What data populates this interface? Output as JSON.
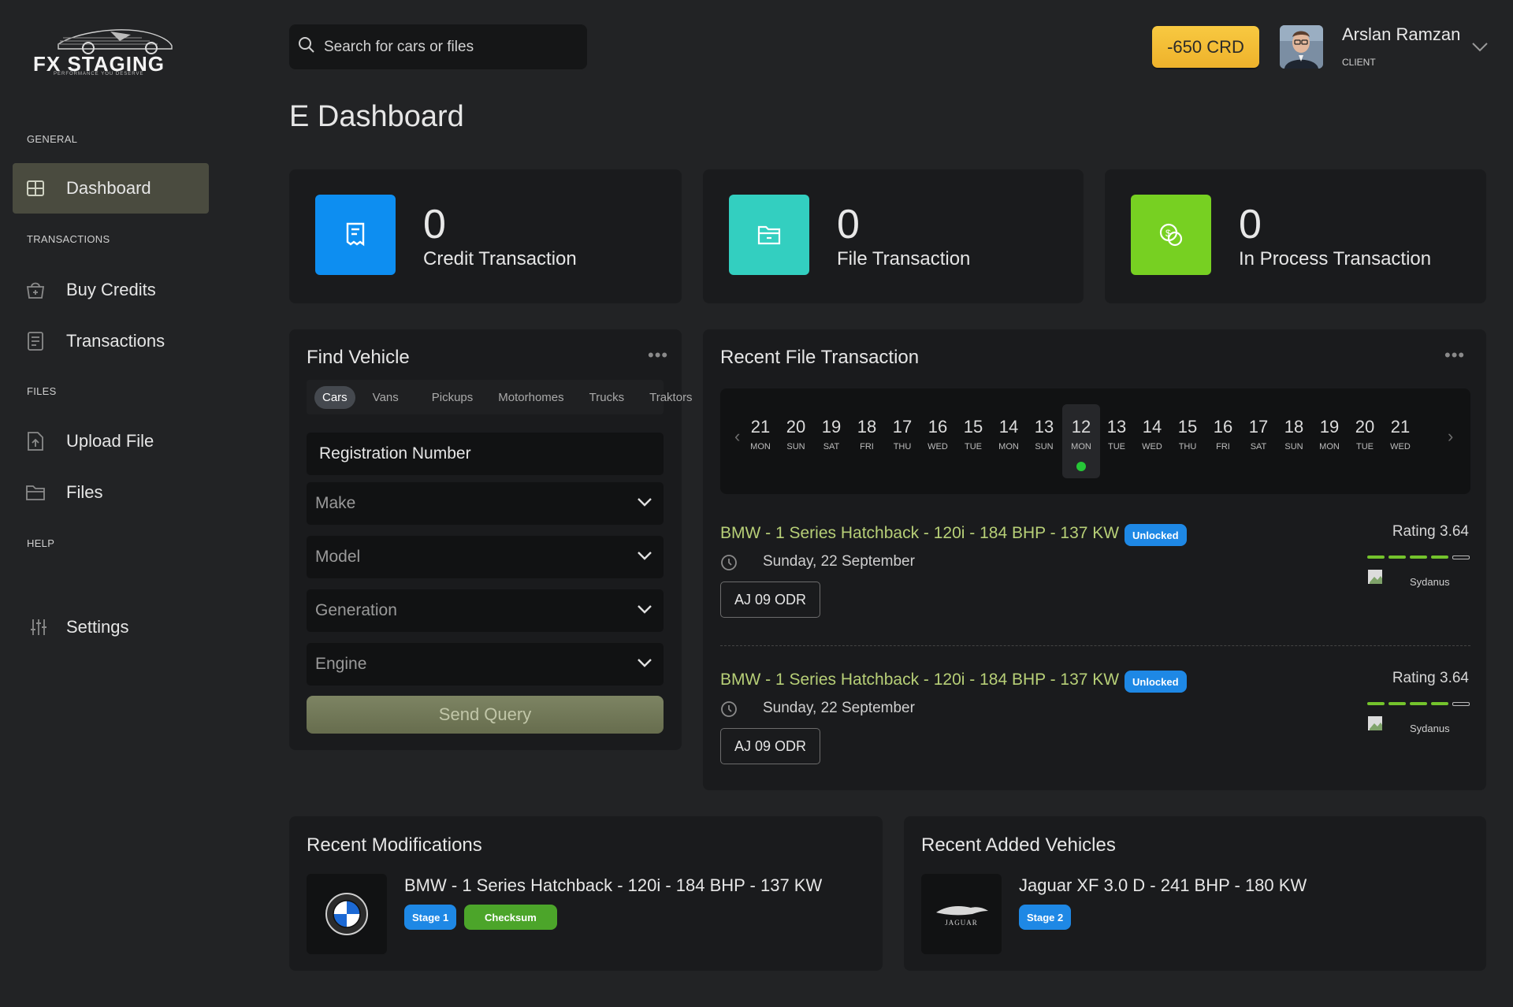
{
  "app": {
    "logo_text": "FX STAGING",
    "logo_tagline": "PERFORMANCE YOU DESERVE"
  },
  "sidebar": {
    "sections": {
      "general": "GENERAL",
      "transactions": "TRANSACTIONS",
      "files": "FILES",
      "help": "HELP"
    },
    "items": [
      {
        "label": "Dashboard",
        "icon": "grid-icon",
        "active": true
      },
      {
        "label": "Buy Credits",
        "icon": "cart-icon"
      },
      {
        "label": "Transactions",
        "icon": "receipt-icon"
      },
      {
        "label": "Upload File",
        "icon": "upload-file-icon"
      },
      {
        "label": "Files",
        "icon": "folder-icon"
      },
      {
        "label": "Settings",
        "icon": "sliders-icon"
      }
    ]
  },
  "search": {
    "placeholder": "Search for cars or files"
  },
  "header": {
    "credits": "-650 CRD",
    "user_name": "Arslan Ramzan",
    "user_role": "CLIENT"
  },
  "page_title": "E Dashboard",
  "stats": [
    {
      "value": "0",
      "label": "Credit Transaction",
      "color": "#0d8ef1",
      "icon": "receipt-icon"
    },
    {
      "value": "0",
      "label": "File Transaction",
      "color": "#33cfc0",
      "icon": "folder-icon"
    },
    {
      "value": "0",
      "label": "In Process Transaction",
      "color": "#77d022",
      "icon": "coins-icon"
    }
  ],
  "find_vehicle": {
    "title": "Find Vehicle",
    "tabs": [
      "Cars",
      "Vans",
      "Pickups",
      "Motorhomes",
      "Trucks",
      "Traktors"
    ],
    "active_tab": "Cars",
    "registration_placeholder": "Registration Number",
    "selects": [
      "Make",
      "Model",
      "Generation",
      "Engine"
    ],
    "submit": "Send Query"
  },
  "recent_file_transaction": {
    "title": "Recent File Transaction",
    "calendar": [
      {
        "num": "21",
        "dow": "MON"
      },
      {
        "num": "20",
        "dow": "SUN"
      },
      {
        "num": "19",
        "dow": "SAT"
      },
      {
        "num": "18",
        "dow": "FRI"
      },
      {
        "num": "17",
        "dow": "THU"
      },
      {
        "num": "16",
        "dow": "WED"
      },
      {
        "num": "15",
        "dow": "TUE"
      },
      {
        "num": "14",
        "dow": "MON"
      },
      {
        "num": "13",
        "dow": "SUN"
      },
      {
        "num": "12",
        "dow": "MON",
        "selected": true
      },
      {
        "num": "13",
        "dow": "TUE"
      },
      {
        "num": "14",
        "dow": "WED"
      },
      {
        "num": "15",
        "dow": "THU"
      },
      {
        "num": "16",
        "dow": "FRI"
      },
      {
        "num": "17",
        "dow": "SAT"
      },
      {
        "num": "18",
        "dow": "SUN"
      },
      {
        "num": "19",
        "dow": "MON"
      },
      {
        "num": "20",
        "dow": "TUE"
      },
      {
        "num": "21",
        "dow": "WED"
      }
    ],
    "items": [
      {
        "title": "BMW - 1 Series Hatchback - 120i - 184 BHP - 137 KW",
        "status": "Unlocked",
        "date": "Sunday, 22 September",
        "plate": "AJ 09 ODR",
        "rating_label": "Rating 3.64",
        "rating_filled": 4,
        "rating_total": 5,
        "user": "Sydanus"
      },
      {
        "title": "BMW - 1 Series Hatchback - 120i - 184 BHP - 137 KW",
        "status": "Unlocked",
        "date": "Sunday, 22 September",
        "plate": "AJ 09 ODR",
        "rating_label": "Rating 3.64",
        "rating_filled": 4,
        "rating_total": 5,
        "user": "Sydanus"
      }
    ]
  },
  "recent_modifications": {
    "title": "Recent Modifications",
    "item": {
      "title": "BMW - 1 Series Hatchback - 120i - 184 BHP - 137 KW",
      "tags": [
        {
          "label": "Stage 1",
          "color": "#1e88e5"
        },
        {
          "label": "Checksum",
          "color": "#4ca52a"
        }
      ],
      "logo": "bmw-logo"
    }
  },
  "recent_added_vehicles": {
    "title": "Recent Added Vehicles",
    "item": {
      "title": "Jaguar XF 3.0 D - 241 BHP - 180 KW",
      "tags": [
        {
          "label": "Stage 2",
          "color": "#1e88e5"
        }
      ],
      "logo": "jaguar-logo",
      "logo_text": "JAGUAR"
    }
  }
}
